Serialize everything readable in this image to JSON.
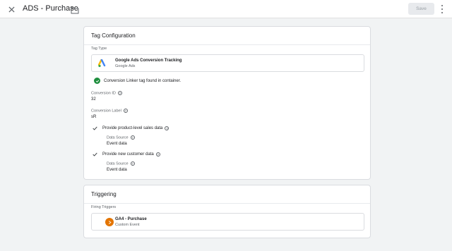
{
  "header": {
    "title": "ADS - Purchase",
    "save_label": "Save"
  },
  "tag_config": {
    "heading": "Tag Configuration",
    "tag_type_label": "Tag Type",
    "tag_type_name": "Google Ads Conversion Tracking",
    "tag_type_vendor": "Google Ads",
    "status_message": "Conversion Linker tag found in container.",
    "conversion_id_label": "Conversion ID",
    "conversion_id_value": "32",
    "conversion_label_label": "Conversion Label",
    "conversion_label_value": "sR",
    "product_sales": {
      "label": "Provide product-level sales data",
      "data_source_label": "Data Source",
      "data_source_value": "Event data"
    },
    "new_customer": {
      "label": "Provide new customer data",
      "data_source_label": "Data Source",
      "data_source_value": "Event data"
    }
  },
  "triggering": {
    "heading": "Triggering",
    "firing_label": "Firing Triggers",
    "trigger_name": "GA4 - Purchase",
    "trigger_type": "Custom Event"
  },
  "colors": {
    "success": "#1e8e3e",
    "trigger_icon": "#e37400"
  }
}
